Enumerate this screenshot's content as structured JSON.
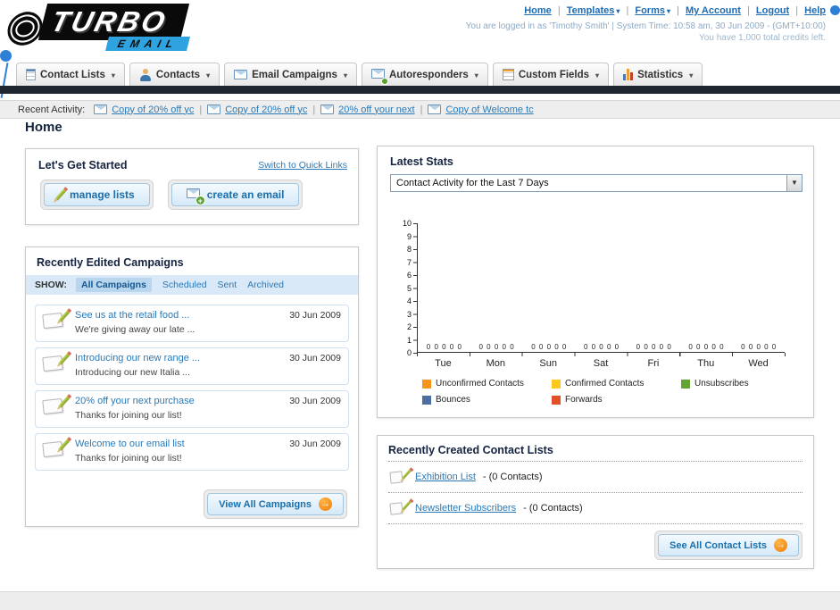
{
  "ui": {
    "sep": "|"
  },
  "header": {
    "logo_top": "TURBO",
    "logo_bottom": "EMAIL",
    "links": [
      {
        "label": "Home"
      },
      {
        "label": "Templates"
      },
      {
        "label": "Forms"
      },
      {
        "label": "My Account"
      },
      {
        "label": "Logout"
      },
      {
        "label": "Help"
      }
    ],
    "login_info": "You are logged in as 'Timothy Smith' | System Time: 10:58 am, 30 Jun 2009 - (GMT+10:00)",
    "credits_info": "You have 1,000 total credits left."
  },
  "main_nav": {
    "items": [
      {
        "label": "Contact Lists"
      },
      {
        "label": "Contacts"
      },
      {
        "label": "Email Campaigns"
      },
      {
        "label": "Autoresponders"
      },
      {
        "label": "Custom Fields"
      },
      {
        "label": "Statistics"
      }
    ]
  },
  "recent_activity": {
    "label": "Recent Activity:",
    "items": [
      {
        "label": "Copy of 20% off yc"
      },
      {
        "label": "Copy of 20% off yc"
      },
      {
        "label": "20% off your next"
      },
      {
        "label": "Copy of Welcome tc"
      }
    ]
  },
  "page_title": "Home",
  "get_started": {
    "title": "Let's Get Started",
    "switch_link": "Switch to Quick Links",
    "manage_lists_label": "manage lists",
    "create_email_label": "create an email"
  },
  "campaigns": {
    "title": "Recently Edited Campaigns",
    "show_label": "SHOW:",
    "tabs": [
      {
        "label": "All Campaigns",
        "selected": true
      },
      {
        "label": "Scheduled",
        "selected": false
      },
      {
        "label": "Sent",
        "selected": false
      },
      {
        "label": "Archived",
        "selected": false
      }
    ],
    "items": [
      {
        "title": "See us at the retail food ...",
        "subtitle": "We're giving away our late ...",
        "date": "30 Jun 2009"
      },
      {
        "title": "Introducing our new range ...",
        "subtitle": "Introducing our new Italia ...",
        "date": "30 Jun 2009"
      },
      {
        "title": "20% off your next purchase",
        "subtitle": "Thanks for joining our list!",
        "date": "30 Jun 2009"
      },
      {
        "title": "Welcome to our email list",
        "subtitle": "Thanks for joining our list!",
        "date": "30 Jun 2009"
      }
    ],
    "view_all_label": "View All Campaigns"
  },
  "stats": {
    "title": "Latest Stats",
    "period_selected": "Contact Activity for the Last 7 Days",
    "chart_data": {
      "type": "bar",
      "title": "Contact Activity for the Last 7 Days",
      "categories": [
        "Tue",
        "Mon",
        "Sun",
        "Sat",
        "Fri",
        "Thu",
        "Wed"
      ],
      "series": [
        {
          "name": "Unconfirmed Contacts",
          "color": "#f7941d",
          "values": [
            0,
            0,
            0,
            0,
            0,
            0,
            0
          ]
        },
        {
          "name": "Confirmed Contacts",
          "color": "#fdc91e",
          "values": [
            0,
            0,
            0,
            0,
            0,
            0,
            0
          ]
        },
        {
          "name": "Unsubscribes",
          "color": "#62a331",
          "values": [
            0,
            0,
            0,
            0,
            0,
            0,
            0
          ]
        },
        {
          "name": "Bounces",
          "color": "#4d6fa0",
          "values": [
            0,
            0,
            0,
            0,
            0,
            0,
            0
          ]
        },
        {
          "name": "Forwards",
          "color": "#e2502a",
          "values": [
            0,
            0,
            0,
            0,
            0,
            0,
            0
          ]
        }
      ],
      "ylim": [
        0,
        10
      ],
      "y_tick_step": 1,
      "grid": false,
      "legend_position": "bottom",
      "show_value_labels": true
    }
  },
  "contact_lists": {
    "title": "Recently Created Contact Lists",
    "items": [
      {
        "name": "Exhibition List",
        "suffix": "- (0 Contacts)"
      },
      {
        "name": "Newsletter Subscribers",
        "suffix": "- (0 Contacts)"
      }
    ],
    "see_all_label": "See All Contact Lists"
  }
}
